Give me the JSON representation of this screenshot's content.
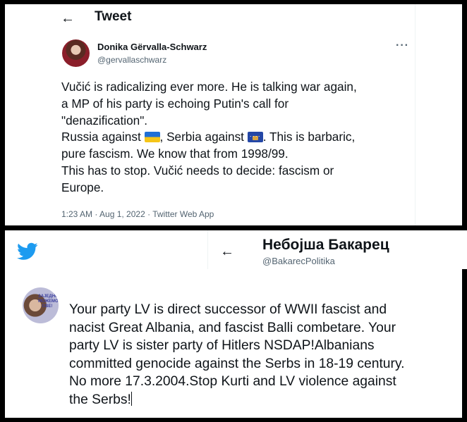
{
  "tweet1": {
    "header_title": "Tweet",
    "author_name": "Donika Gërvalla-Schwarz",
    "author_handle": "@gervallaschwarz",
    "more_label": "···",
    "text_part1": "Vučić is radicalizing ever more. He is talking war again,\na MP of his party is echoing Putin's call for\n\"denazification\".\nRussia against ",
    "flag1": "ukraine-flag",
    "text_part2": ", Serbia against ",
    "flag2": "kosovo-flag",
    "text_part3": ". This is barbaric,\npure fascism. We know that from 1998/99.\nThis has to stop. Vučić needs to decide: fascism or\nEurope.",
    "meta": "1:23 AM · Aug 1, 2022 · Twitter Web App"
  },
  "tweet2": {
    "author_name": "Небојша Бакарец",
    "author_handle": "@BakarecPolitika",
    "avatar_text": "ЗАЈЕДНО МОЖЕМО СВЕ!",
    "text": "Your party LV is direct successor of WWII fascist and\nnacist Great Albania, and fascist Balli combetare. Your\nparty LV is sister party of Hitlers NSDAP!Albanians\ncommitted genocide against the Serbs in 18-19 century.\nNo more 17.3.2004.Stop Kurti and LV violence against\nthe Serbs!"
  },
  "icons": {
    "back": "←",
    "twitter_logo": "twitter-bird-icon"
  },
  "colors": {
    "twitter_blue": "#1d9bf0",
    "text": "#0f1419",
    "secondary_text": "#536471"
  }
}
